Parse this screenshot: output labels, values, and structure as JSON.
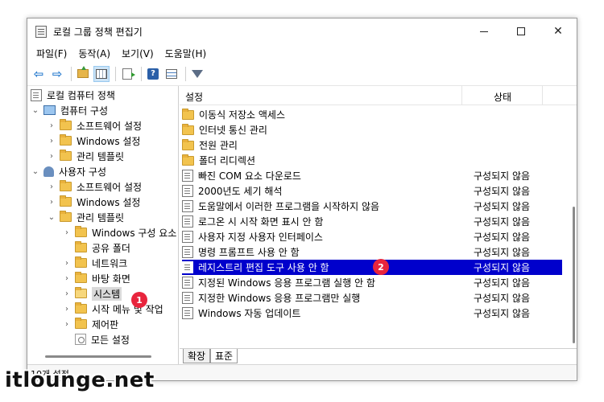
{
  "window": {
    "title": "로컬 그룹 정책 편집기",
    "close_glyph": "✕"
  },
  "menu": [
    "파일(F)",
    "동작(A)",
    "보기(V)",
    "도움말(H)"
  ],
  "tree": {
    "root": "로컬 컴퓨터 정책",
    "computer": "컴퓨터 구성",
    "computer_children": [
      "소프트웨어 설정",
      "Windows 설정",
      "관리 템플릿"
    ],
    "user": "사용자 구성",
    "user_children": [
      "소프트웨어 설정",
      "Windows 설정",
      "관리 템플릿"
    ],
    "admin_children": [
      "Windows 구성 요소",
      "공유 폴더",
      "네트워크",
      "바탕 화면",
      "시스템",
      "시작 메뉴 및 작업",
      "제어판",
      "모든 설정"
    ]
  },
  "list": {
    "col_setting": "설정",
    "col_state": "상태",
    "folders": [
      "이동식 저장소 액세스",
      "인터넷 통신 관리",
      "전원 관리",
      "폴더 리디렉션"
    ],
    "policies": [
      {
        "name": "빠진 COM 요소 다운로드",
        "state": "구성되지 않음"
      },
      {
        "name": "2000년도 세기 해석",
        "state": "구성되지 않음"
      },
      {
        "name": "도움말에서 이러한 프로그램을 시작하지 않음",
        "state": "구성되지 않음"
      },
      {
        "name": "로그온 시 시작 화면 표시 안 함",
        "state": "구성되지 않음"
      },
      {
        "name": "사용자 지정 사용자 인터페이스",
        "state": "구성되지 않음"
      },
      {
        "name": "명령 프롬프트 사용 안 함",
        "state": "구성되지 않음"
      },
      {
        "name": "레지스트리 편집 도구 사용 안 함",
        "state": "구성되지 않음"
      },
      {
        "name": "지정된 Windows 응용 프로그램 실행 안 함",
        "state": "구성되지 않음"
      },
      {
        "name": "지정한 Windows 응용 프로그램만 실행",
        "state": "구성되지 않음"
      },
      {
        "name": "Windows 자동 업데이트",
        "state": "구성되지 않음"
      }
    ]
  },
  "tabs": [
    "확장",
    "표준"
  ],
  "status": "10개 설정",
  "badges": [
    "1",
    "2"
  ],
  "watermark": "itlounge.net",
  "colors": {
    "selection": "#0000cc",
    "badge": "#e8253d"
  }
}
